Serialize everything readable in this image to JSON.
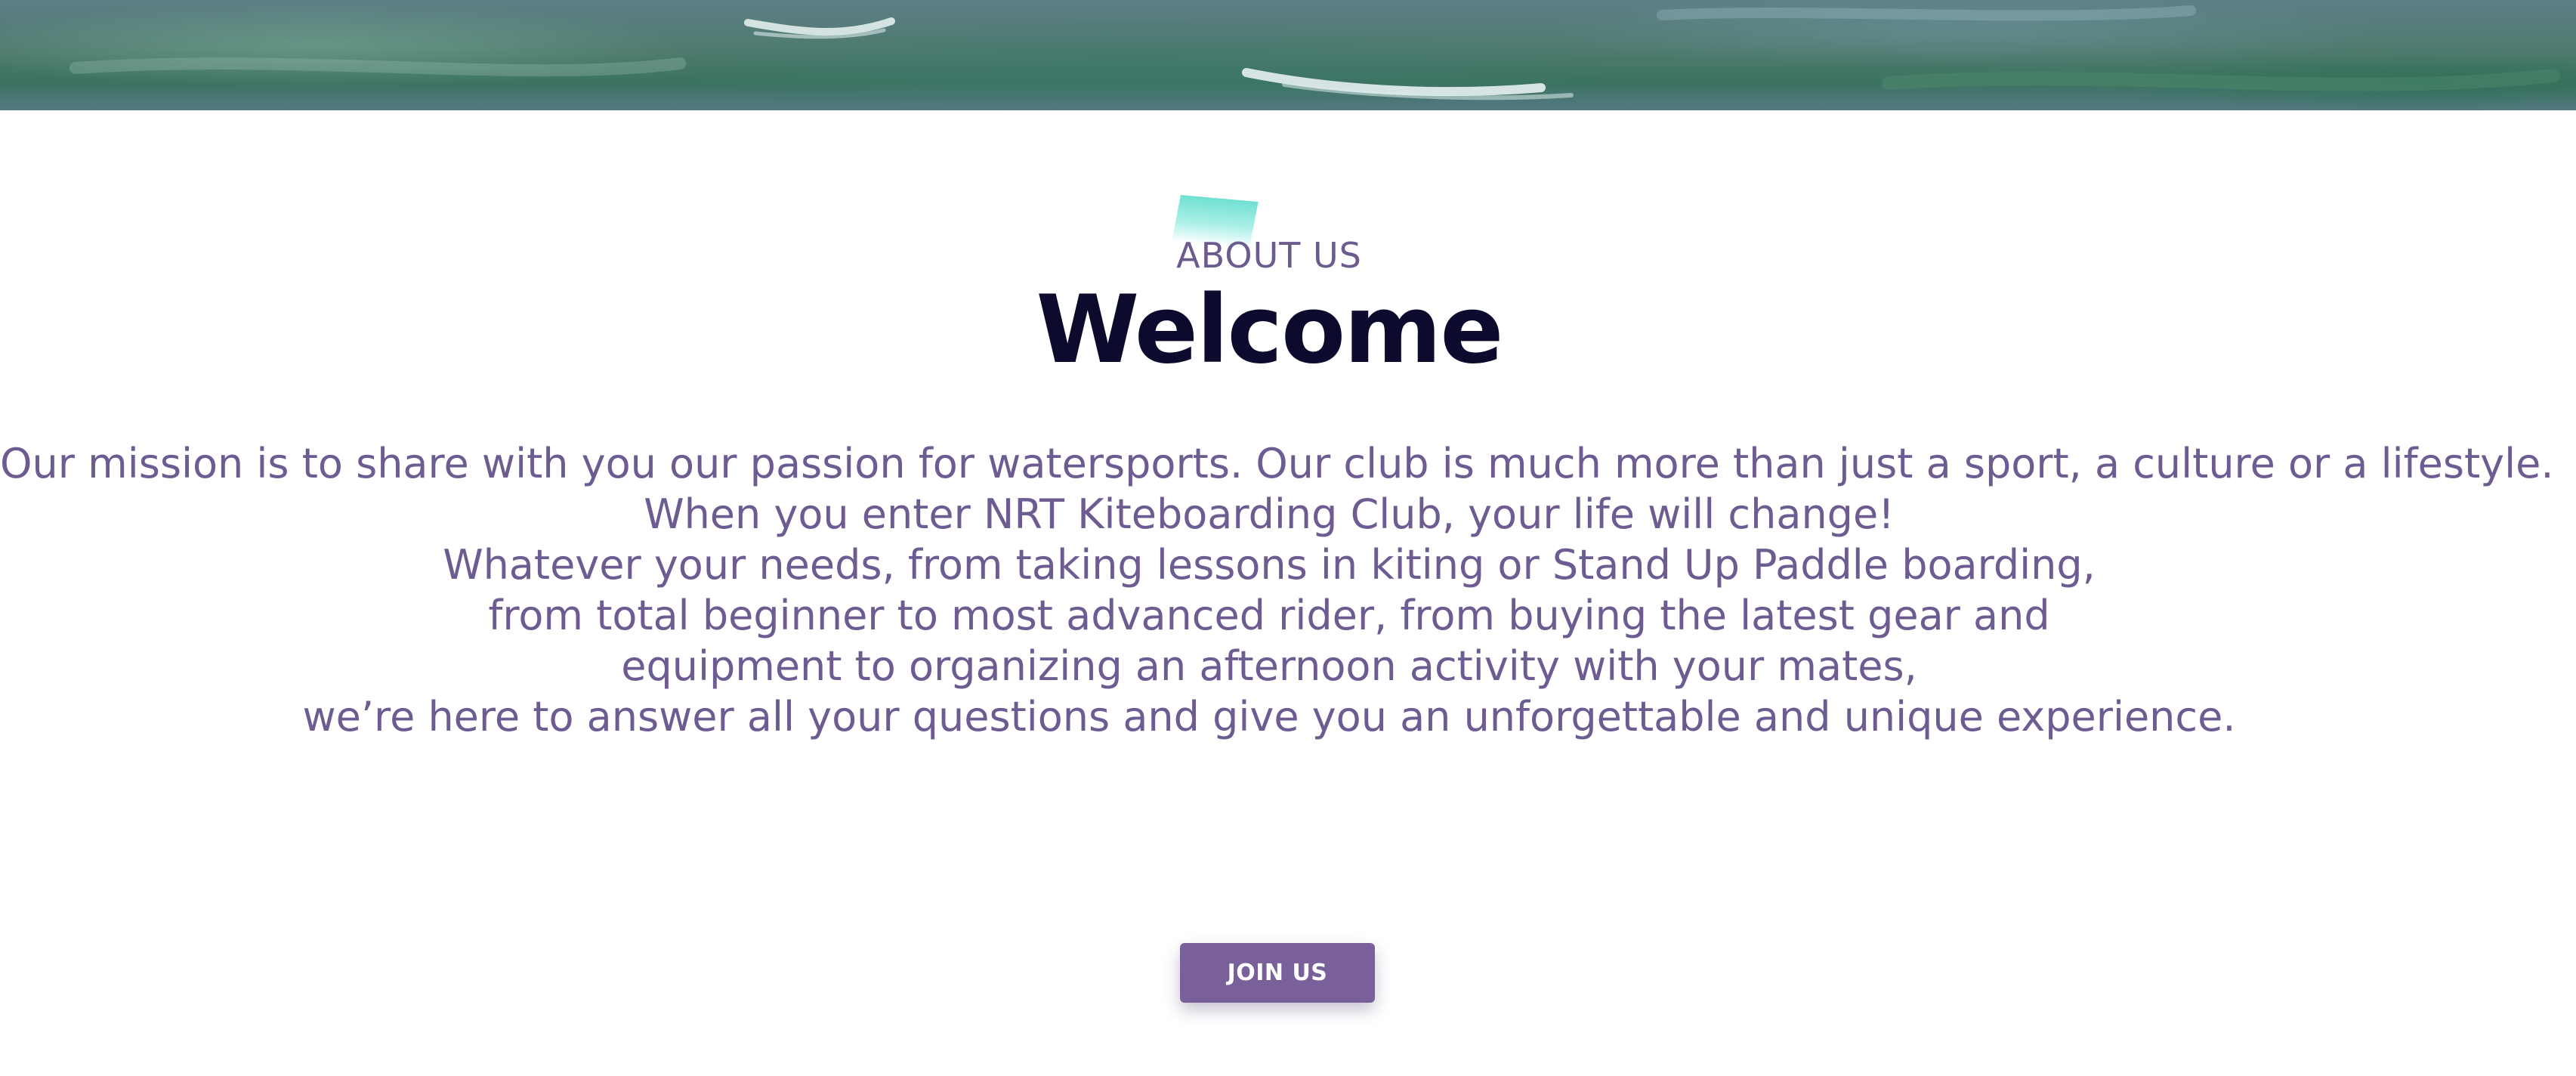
{
  "hero": {
    "image_description_icon": "water-waves-banner"
  },
  "about": {
    "eyebrow": "ABOUT US",
    "title": "Welcome",
    "mission_lines": [
      "Our mission is to share with you our passion for watersports. Our club is much more than just a sport, a culture or a lifestyle.",
      "When you enter NRT Kiteboarding Club, your life will change!",
      "Whatever your needs, from taking lessons in kiting or Stand Up Paddle boarding,",
      "from total beginner to most advanced rider, from buying the latest gear and",
      "equipment to organizing an afternoon activity with your mates,",
      "we’re here to answer all your questions and give you an unforgettable and unique experience."
    ]
  },
  "cta": {
    "join_label": "JOIN US"
  },
  "colors": {
    "accent": "#7a609a",
    "heading": "#0c0b2e",
    "body_text": "#6d5c92",
    "accent_shape": "#6fe0d2"
  }
}
